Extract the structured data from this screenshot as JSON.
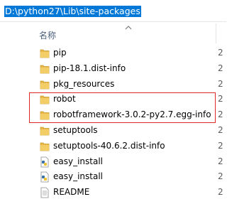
{
  "address_bar": {
    "path": "D:\\python27\\Lib\\site-packages"
  },
  "column_header": {
    "name": "名称",
    "next_column_glyph": ""
  },
  "colors": {
    "accent_selection": "#0078d7",
    "folder_fill": "#e8b94a",
    "highlight_box": "#e02828"
  },
  "files": [
    {
      "name": "pip",
      "icon": "folder-icon",
      "tail": "2"
    },
    {
      "name": "pip-18.1.dist-info",
      "icon": "folder-icon",
      "tail": "2"
    },
    {
      "name": "pkg_resources",
      "icon": "folder-icon",
      "tail": "2"
    },
    {
      "name": "robot",
      "icon": "folder-icon",
      "tail": "2"
    },
    {
      "name": "robotframework-3.0.2-py2.7.egg-info",
      "icon": "folder-icon",
      "tail": "2"
    },
    {
      "name": "setuptools",
      "icon": "folder-icon",
      "tail": "2"
    },
    {
      "name": "setuptools-40.6.2.dist-info",
      "icon": "folder-icon",
      "tail": "2"
    },
    {
      "name": "easy_install",
      "icon": "python-file-icon",
      "tail": "2"
    },
    {
      "name": "easy_install",
      "icon": "python-file-icon",
      "tail": "2"
    },
    {
      "name": "README",
      "icon": "text-file-icon",
      "tail": "2"
    }
  ]
}
